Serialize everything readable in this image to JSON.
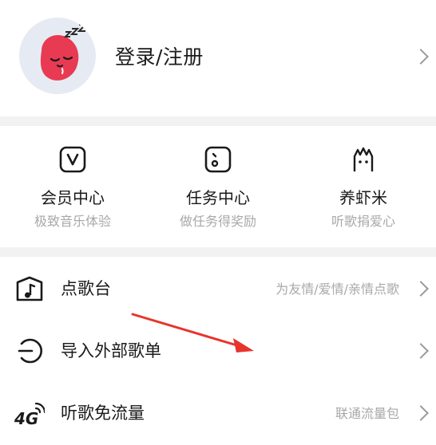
{
  "profile": {
    "login_label": "登录/注册"
  },
  "features": [
    {
      "icon": "vip-v-icon",
      "title": "会员中心",
      "subtitle": "极致音乐体验"
    },
    {
      "icon": "task-face-icon",
      "title": "任务中心",
      "subtitle": "做任务得奖励"
    },
    {
      "icon": "shrimp-icon",
      "title": "养虾米",
      "subtitle": "听歌捐爱心"
    }
  ],
  "menu": [
    {
      "icon": "music-box-icon",
      "label": "点歌台",
      "hint": "为友情/爱情/亲情点歌"
    },
    {
      "icon": "import-playlist-icon",
      "label": "导入外部歌单",
      "hint": ""
    },
    {
      "icon": "4g-signal-icon",
      "label": "听歌免流量",
      "hint": "联通流量包",
      "badge_text": "4G"
    }
  ],
  "colors": {
    "accent": "#e83a52",
    "annotation": "#e8342c",
    "avatar_bg": "#e6ebf3"
  }
}
